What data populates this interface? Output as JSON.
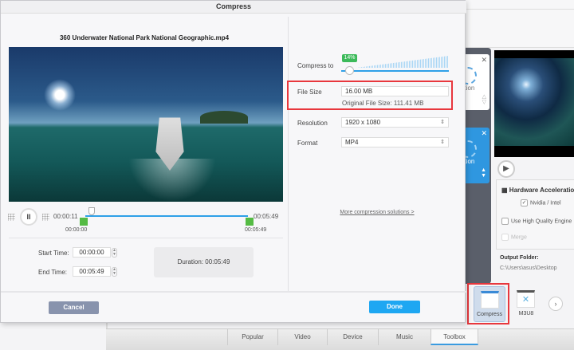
{
  "dialog": {
    "title": "Compress",
    "file_name": "360 Underwater National Park  National Geographic.mp4",
    "player": {
      "current_time": "00:00:11",
      "end_time": "00:05:49",
      "range_start_label": "00:00:00",
      "range_end_label": "00:05:49"
    },
    "start_time": {
      "label": "Start Time:",
      "value": "00:00:00"
    },
    "end_time": {
      "label": "End Time:",
      "value": "00:05:49"
    },
    "duration": "Duration:  00:05:49",
    "compress_to": {
      "label": "Compress to",
      "percent_label": "14%",
      "percent": 14
    },
    "file_size": {
      "label": "File Size",
      "value": "16.00  MB",
      "original": "Original File Size: 111.41 MB"
    },
    "resolution": {
      "label": "Resolution",
      "value": "1920 x 1080"
    },
    "format": {
      "label": "Format",
      "value": "MP4"
    },
    "more_link": "More compression solutions >",
    "cancel_label": "Cancel",
    "done_label": "Done"
  },
  "background": {
    "task_option_label": "otion",
    "hardware_accel": "Hardware Acceleration",
    "nvidia": "Nvidia / Intel",
    "high_quality": "Use High Quality Engine",
    "merge": "Merge",
    "output_folder_label": "Output Folder:",
    "output_folder_path": "C:\\Users\\asus\\Desktop",
    "tools": [
      {
        "label": "Compress"
      },
      {
        "label": "M3U8"
      }
    ],
    "tabs": [
      {
        "label": "Popular"
      },
      {
        "label": "Video"
      },
      {
        "label": "Device"
      },
      {
        "label": "Music"
      },
      {
        "label": "Toolbox"
      }
    ]
  },
  "colors": {
    "accent": "#1ea7f2",
    "highlight": "#e8373d",
    "green": "#3cba5a"
  }
}
